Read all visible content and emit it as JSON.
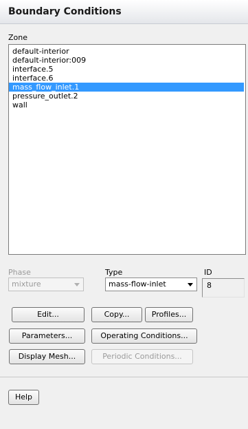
{
  "panel": {
    "title": "Boundary Conditions"
  },
  "zone": {
    "label": "Zone",
    "items": [
      {
        "label": "default-interior"
      },
      {
        "label": "default-interior:009"
      },
      {
        "label": "interface.5"
      },
      {
        "label": "interface.6"
      },
      {
        "label": "mass_flow_inlet.1",
        "selected": true
      },
      {
        "label": "pressure_outlet.2"
      },
      {
        "label": "wall"
      }
    ]
  },
  "phase": {
    "label": "Phase",
    "value": "mixture"
  },
  "type": {
    "label": "Type",
    "value": "mass-flow-inlet"
  },
  "id": {
    "label": "ID",
    "value": "8"
  },
  "buttons": {
    "edit": "Edit...",
    "copy": "Copy...",
    "profiles": "Profiles...",
    "parameters": "Parameters...",
    "operating_conditions": "Operating Conditions...",
    "display_mesh": "Display Mesh...",
    "periodic_conditions": "Periodic Conditions...",
    "help": "Help"
  }
}
